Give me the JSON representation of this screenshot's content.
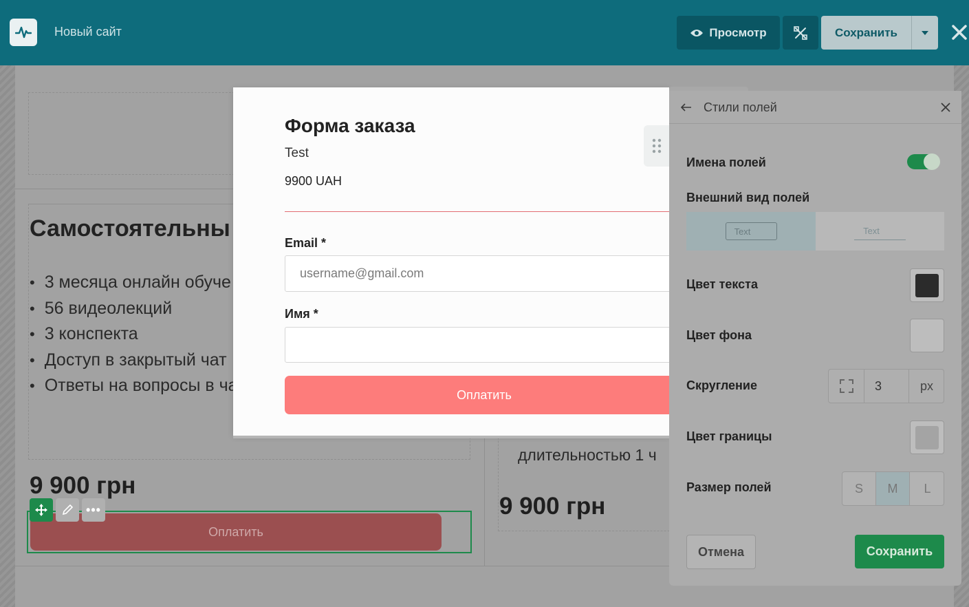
{
  "topbar": {
    "site_title": "Новый сайт",
    "preview_label": "Просмотр",
    "save_label": "Сохранить",
    "logo_icon": "pulse-icon"
  },
  "background": {
    "title": "Самостоятельны",
    "features": [
      "3 месяца онлайн обуче",
      "56 видеолекций",
      "3 конспекта",
      "Доступ в закрытый чат",
      "Ответы на вопросы в ча"
    ],
    "price_left": "9 900 грн",
    "price_right": "9 900 грн",
    "right_text": "длительностью 1 ч",
    "pay_label": "Оплатить"
  },
  "modal": {
    "title": "Форма заказа",
    "subtitle": "Test",
    "price": "9900 UAH",
    "email_label": "Email *",
    "email_placeholder": "username@gmail.com",
    "name_label": "Имя *",
    "name_value": "",
    "pay_label": "Оплатить"
  },
  "panel": {
    "title": "Стили полей",
    "field_names_label": "Имена полей",
    "field_names_enabled": true,
    "appearance_label": "Внешний вид полей",
    "appearance_options": [
      "Text",
      "Text"
    ],
    "appearance_selected": 0,
    "text_color_label": "Цвет текста",
    "text_color": "#2b2b2b",
    "bg_color_label": "Цвет фона",
    "bg_color": "#bdbdbd",
    "radius_label": "Скругление",
    "radius_value": "3",
    "radius_unit": "px",
    "border_color_label": "Цвет границы",
    "border_color": "#a4a4a4",
    "size_label": "Размер полей",
    "sizes": [
      "S",
      "M",
      "L"
    ],
    "size_selected": "M",
    "cancel_label": "Отмена",
    "save_label": "Сохранить"
  },
  "colors": {
    "topbar": "#0e6c7c",
    "accent_green": "#1d8a4b",
    "pay_button": "#fd7c7b"
  }
}
